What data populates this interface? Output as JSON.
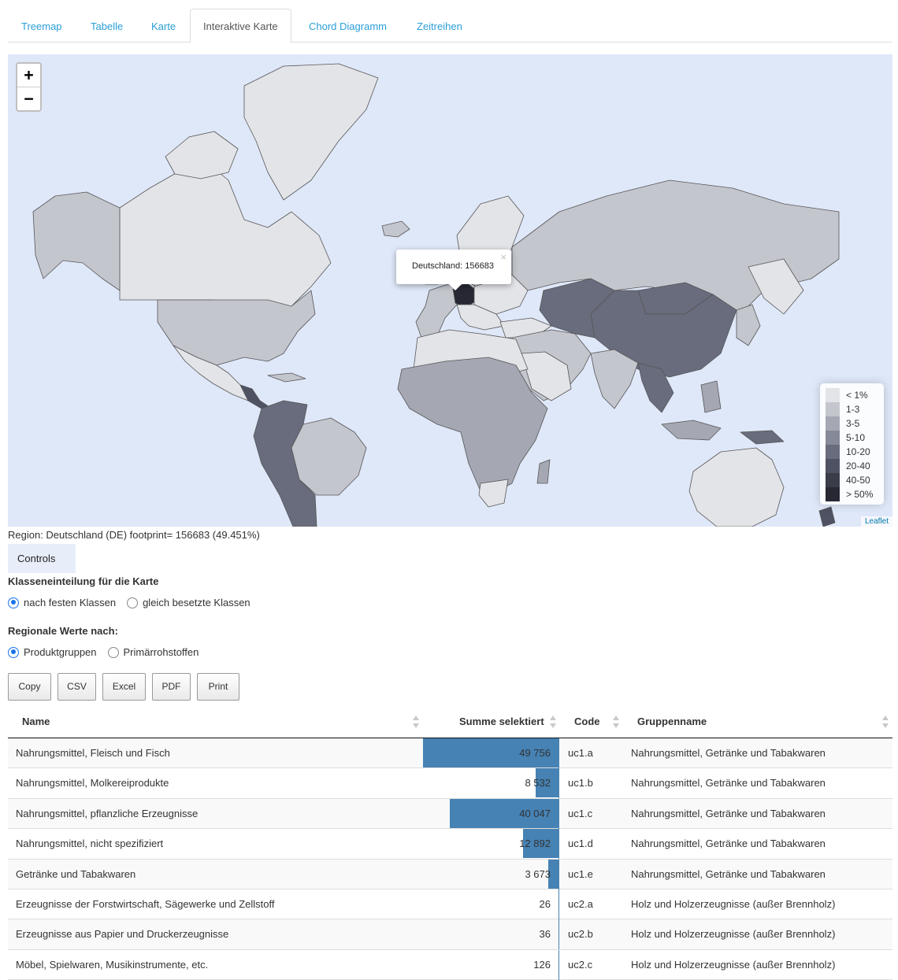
{
  "tabs": [
    {
      "label": "Treemap"
    },
    {
      "label": "Tabelle"
    },
    {
      "label": "Karte"
    },
    {
      "label": "Interaktive Karte"
    },
    {
      "label": "Chord Diagramm"
    },
    {
      "label": "Zeitreihen"
    }
  ],
  "active_tab": 3,
  "map": {
    "zoom_in": "+",
    "zoom_out": "−",
    "popup_text": "Deutschland: 156683",
    "popup_close": "×",
    "attribution": "Leaflet",
    "ocean_color": "#dfe8f9",
    "legend": [
      {
        "label": "< 1%",
        "color": "#e3e4e8"
      },
      {
        "label": "1-3",
        "color": "#c4c6ce"
      },
      {
        "label": "3-5",
        "color": "#a5a8b3"
      },
      {
        "label": "5-10",
        "color": "#868a98"
      },
      {
        "label": "10-20",
        "color": "#686c7d"
      },
      {
        "label": "20-40",
        "color": "#4f5263"
      },
      {
        "label": "40-50",
        "color": "#3a3c4a"
      },
      {
        "label": "> 50%",
        "color": "#272833"
      }
    ]
  },
  "region_text": "Region: Deutschland (DE) footprint= 156683 (49.451%)",
  "controls_label": "Controls",
  "classes": {
    "title": "Klasseneinteilung für die Karte",
    "options": [
      {
        "label": "nach festen Klassen",
        "checked": true
      },
      {
        "label": "gleich besetzte Klassen",
        "checked": false
      }
    ]
  },
  "regional": {
    "title": "Regionale Werte nach:",
    "options": [
      {
        "label": "Produktgruppen",
        "checked": true
      },
      {
        "label": "Primärrohstoffen",
        "checked": false
      }
    ]
  },
  "buttons": {
    "copy": "Copy",
    "csv": "CSV",
    "excel": "Excel",
    "pdf": "PDF",
    "print": "Print"
  },
  "table": {
    "headers": {
      "name": "Name",
      "sum": "Summe selektiert",
      "code": "Code",
      "group": "Gruppenname"
    },
    "bar_color": "#4682b4",
    "rows": [
      {
        "name": "Nahrungsmittel, Fleisch und Fisch",
        "sum": "49 756",
        "value": 49756,
        "code": "uc1.a",
        "group": "Nahrungsmittel, Getränke und Tabakwaren"
      },
      {
        "name": "Nahrungsmittel, Molkereiprodukte",
        "sum": "8 532",
        "value": 8532,
        "code": "uc1.b",
        "group": "Nahrungsmittel, Getränke und Tabakwaren"
      },
      {
        "name": "Nahrungsmittel, pflanzliche Erzeugnisse",
        "sum": "40 047",
        "value": 40047,
        "code": "uc1.c",
        "group": "Nahrungsmittel, Getränke und Tabakwaren"
      },
      {
        "name": "Nahrungsmittel, nicht spezifiziert",
        "sum": "12 892",
        "value": 12892,
        "code": "uc1.d",
        "group": "Nahrungsmittel, Getränke und Tabakwaren"
      },
      {
        "name": "Getränke und Tabakwaren",
        "sum": "3 673",
        "value": 3673,
        "code": "uc1.e",
        "group": "Nahrungsmittel, Getränke und Tabakwaren"
      },
      {
        "name": "Erzeugnisse der Forstwirtschaft, Sägewerke und Zellstoff",
        "sum": "26",
        "value": 26,
        "code": "uc2.a",
        "group": "Holz und Holzerzeugnisse (außer Brennholz)"
      },
      {
        "name": "Erzeugnisse aus Papier und Druckerzeugnisse",
        "sum": "36",
        "value": 36,
        "code": "uc2.b",
        "group": "Holz und Holzerzeugnisse (außer Brennholz)"
      },
      {
        "name": "Möbel, Spielwaren, Musikinstrumente, etc.",
        "sum": "126",
        "value": 126,
        "code": "uc2.c",
        "group": "Holz und Holzerzeugnisse (außer Brennholz)"
      }
    ]
  }
}
